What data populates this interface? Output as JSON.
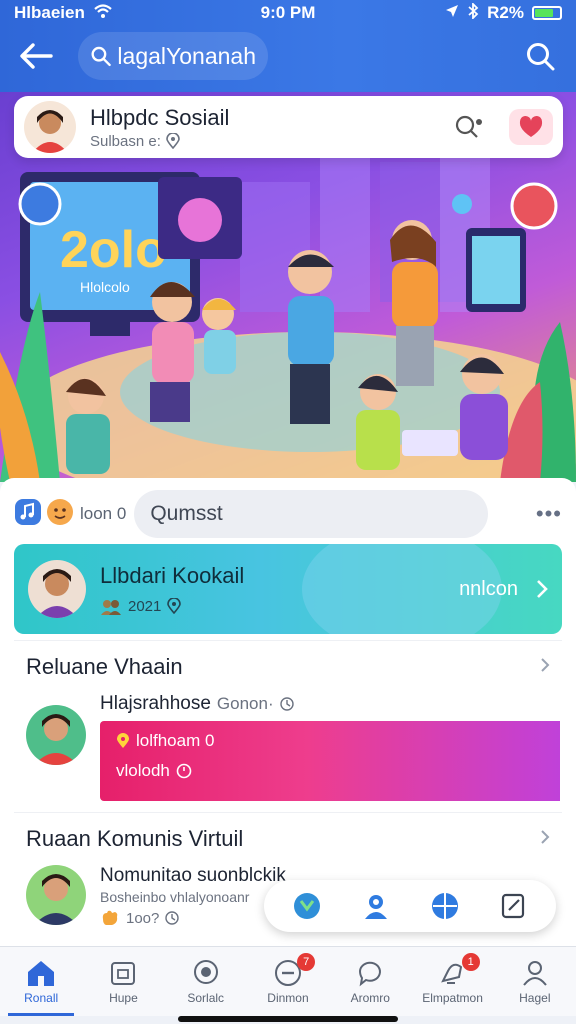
{
  "status_bar": {
    "carrier": "Hlbaeien",
    "time": "9:0 PM",
    "battery": "R2%"
  },
  "header": {
    "search_text": "lagalYonanah"
  },
  "profile_card": {
    "name": "Hlbpdc Sosiail",
    "subtitle": "Sulbasn e:"
  },
  "hero": {
    "screen_text_big": "2olo",
    "screen_text_small": "Hlolcolo"
  },
  "composer": {
    "label": "loon 0",
    "placeholder": "Qumsst"
  },
  "featured": {
    "title": "Llbdari Kookail",
    "subtitle": "2021",
    "link": "nnlcon"
  },
  "section1": {
    "title": "Reluane Vhaain",
    "item_title": "Hlajsrahhose",
    "item_muted": "Gonon·",
    "card_line1": "lolfhoam 0",
    "card_line2": "vlolodh"
  },
  "section2": {
    "title": "Ruaan Komunis Virtuil",
    "item_title": "Nomunitao suonblckik",
    "item_sub": "Bosheinbo vhlalyonoanr",
    "item_meta": "1oo?"
  },
  "bottom_nav": [
    {
      "label": "Ronall",
      "icon": "home-icon"
    },
    {
      "label": "Hupe",
      "icon": "calendar-icon"
    },
    {
      "label": "Sorlalc",
      "icon": "chat-bubble-icon"
    },
    {
      "label": "Dinmon",
      "icon": "minus-circle-icon",
      "badge": "7"
    },
    {
      "label": "Aromro",
      "icon": "comment-icon"
    },
    {
      "label": "Elmpatmon",
      "icon": "bell-chat-icon",
      "badge": "1"
    },
    {
      "label": "Hagel",
      "icon": "person-icon"
    }
  ],
  "colors": {
    "primary": "#2f67d8",
    "featured_teal": "#2fc6c8",
    "pink": "#e6206a",
    "badge": "#e53935"
  }
}
